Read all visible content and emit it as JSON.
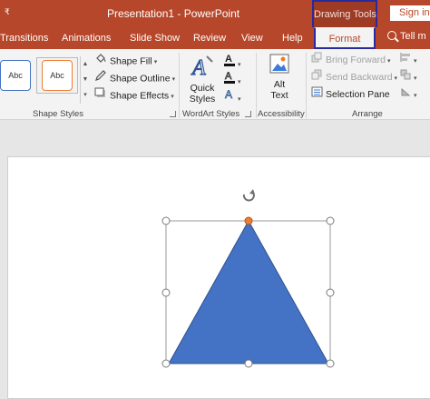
{
  "title_bar": {
    "qat_glyph": "₹",
    "document_title": "Presentation1  -  PowerPoint",
    "context_group": "Drawing Tools",
    "sign_in": "Sign in"
  },
  "tabs": [
    {
      "label": "Transitions"
    },
    {
      "label": "Animations"
    },
    {
      "label": "Slide Show"
    },
    {
      "label": "Review"
    },
    {
      "label": "View"
    },
    {
      "label": "Help"
    },
    {
      "label": "Format",
      "active": true
    }
  ],
  "tell_me": "Tell m",
  "ribbon": {
    "shape_styles": {
      "label": "Shape Styles",
      "gallery": [
        "Abc",
        "Abc"
      ],
      "fill": "Shape Fill",
      "outline": "Shape Outline",
      "effects": "Shape Effects"
    },
    "wordart": {
      "label": "WordArt Styles",
      "quick_styles": [
        "Quick",
        "Styles"
      ]
    },
    "accessibility": {
      "label": "Accessibility",
      "alt_text": [
        "Alt",
        "Text"
      ]
    },
    "arrange": {
      "label": "Arrange",
      "bring_forward": "Bring Forward",
      "send_backward": "Send Backward",
      "selection_pane": "Selection Pane"
    }
  },
  "colors": {
    "accent": "#b7472a",
    "context_highlight": "#2a2a9c",
    "shape_fill": "#4472c4",
    "shape_outline": "#2f528f",
    "adjust_handle": "#ed7d31"
  }
}
